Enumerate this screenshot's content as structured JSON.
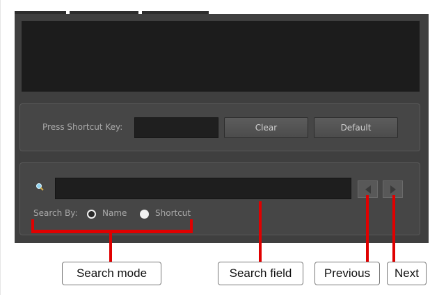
{
  "shortcut": {
    "label": "Press Shortcut Key:",
    "clear_label": "Clear",
    "default_label": "Default"
  },
  "search": {
    "search_by_label": "Search By:",
    "options": [
      "Name",
      "Shortcut"
    ],
    "selected": "Shortcut"
  },
  "callouts": {
    "search_mode": "Search mode",
    "search_field": "Search field",
    "previous": "Previous",
    "next": "Next"
  },
  "colors": {
    "panel": "#3f3f3f",
    "callout_line": "#e00000"
  },
  "icons": {
    "search": "search-icon",
    "previous": "triangle-left-icon",
    "next": "triangle-right-icon"
  }
}
